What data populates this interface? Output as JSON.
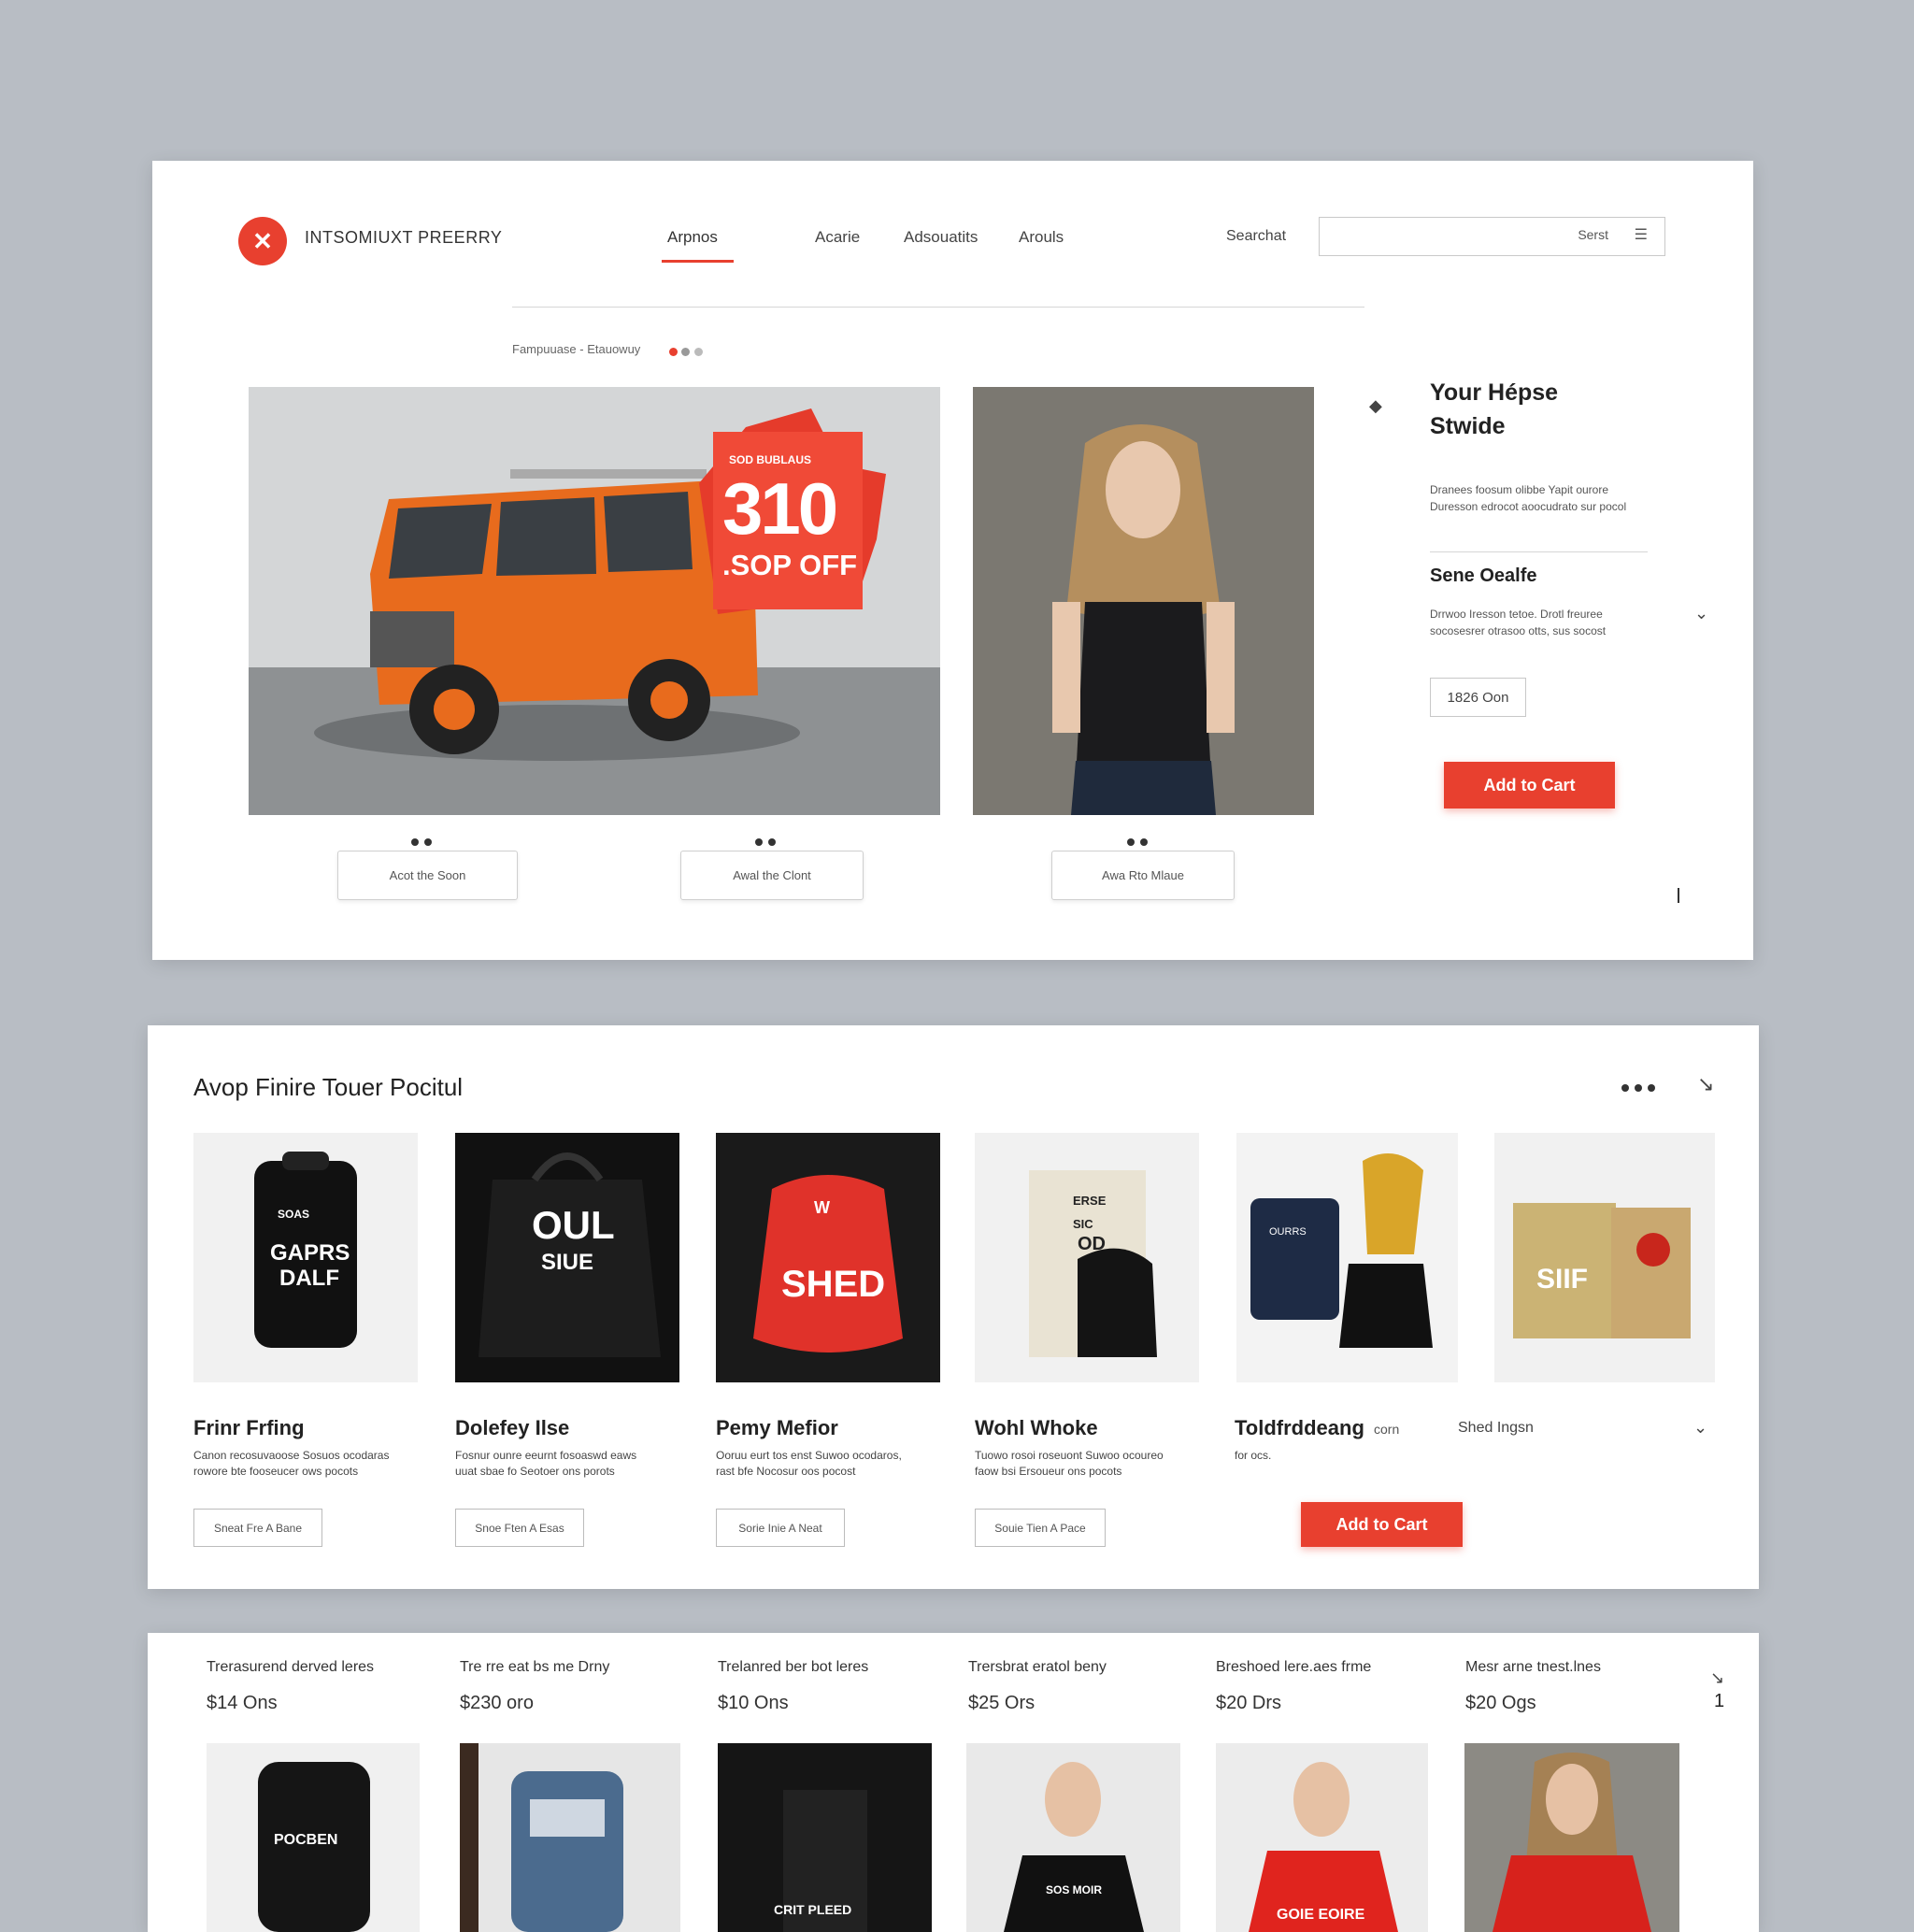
{
  "header": {
    "brand": "INTSOMIUXT PREERRY",
    "nav": [
      "Arpnos",
      "Acarie",
      "Adsouatits",
      "Arouls"
    ],
    "search_label": "Searchat",
    "search_button": "Serst"
  },
  "breadcrumb": "Fampuuase - Etauowuy",
  "hero": {
    "promo_small": "SOD BUBLAUS",
    "promo_big": "310",
    "promo_off": ".SOP OFF",
    "buttons": [
      "Acot the Soon",
      "Awal the Clont",
      "Awa Rto Mlaue"
    ]
  },
  "sidebar": {
    "title": "Your Hépse Stwide",
    "text1": "Dranees foosum olibbe Yapit ourore Duresson edrocot aoocudrato sur pocol",
    "subtitle": "Sene Oealfe",
    "text2": "Drrwoo Iresson tetoe. Drotl freuree socosesrer otrasoo otts, sus socost",
    "qty": "1826 Oon",
    "add_to_cart": "Add to Cart"
  },
  "section2": {
    "title": "Avop Finire Touer Pocitul",
    "products": [
      {
        "name": "Frinr Frfing",
        "desc": "Canon recosuvaoose Sosuos ocodaras rowore bte fooseucer ows pocots",
        "button": "Sneat Fre A Bane"
      },
      {
        "name": "Dolefey Ilse",
        "desc": "Fosnur ounre eeurnt fosoaswd eaws uuat sbae fo Seotoer ons porots",
        "button": "Snoe Ften A Esas"
      },
      {
        "name": "Pemy Mefior",
        "desc": "Ooruu eurt tos enst Suwoo ocodaros, rast bfe Nocosur oos pocost",
        "button": "Sorie Inie A Neat"
      },
      {
        "name": "Wohl Whoke",
        "desc": "Tuowo rosoi roseuont Suwoo ocoureo faow bsi Ersoueur ons pocots",
        "button": "Souie Tien A Pace"
      },
      {
        "name": "Toldfrddeang",
        "desc": "for ocs.",
        "extra": "corn",
        "button": ""
      },
      {
        "name": "",
        "desc": "",
        "extra": "Shed Ingsn",
        "button": ""
      }
    ],
    "add_to_cart": "Add to Cart",
    "product_images": [
      {
        "line1": "GAPRS",
        "line2": "DALF",
        "top": "SOAS"
      },
      {
        "line1": "OUL",
        "line2": "SIUE",
        "top": ""
      },
      {
        "line1": "SHED",
        "line2": "",
        "top": "W"
      },
      {
        "line1": "SIC",
        "line2": "OD",
        "top": "ERSE"
      },
      {
        "line1": "OURRS",
        "line2": "",
        "top": ""
      },
      {
        "line1": "SIIF",
        "line2": "",
        "top": ""
      }
    ]
  },
  "section3": {
    "items": [
      {
        "name": "Trerasurend derved leres",
        "price": "$14 Ons"
      },
      {
        "name": "Tre rre eat bs me Drny",
        "price": "$230 oro"
      },
      {
        "name": "Trelanred ber bot leres",
        "price": "$10 Ons"
      },
      {
        "name": "Trersbrat eratol beny",
        "price": "$25 Ors"
      },
      {
        "name": "Breshoed lere.aes frme",
        "price": "$20 Drs"
      },
      {
        "name": "Mesr arne tnest.lnes",
        "price": "$20 Ogs"
      }
    ],
    "images": [
      {
        "text": "POCBEN"
      },
      {
        "text": ""
      },
      {
        "text": "CRIT PLEED"
      },
      {
        "text": "SOS MOIR"
      },
      {
        "text": "GOIE EOIRE"
      },
      {
        "text": ""
      }
    ],
    "side_number": "1"
  },
  "colors": {
    "accent": "#e8402f",
    "background": "#b8bdc4"
  }
}
